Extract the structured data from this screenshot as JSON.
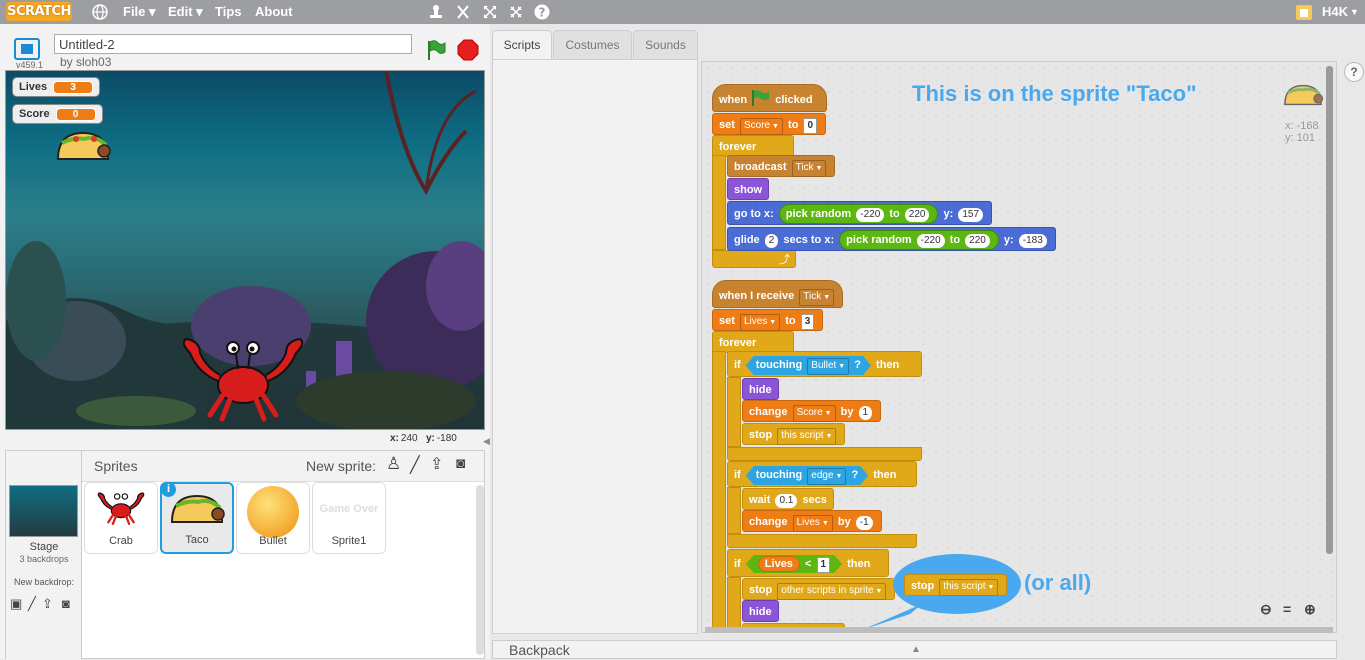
{
  "app": {
    "logo": "SCRATCH",
    "menu": [
      "File ▾",
      "Edit ▾",
      "Tips",
      "About"
    ],
    "user": "H4K"
  },
  "project": {
    "title": "Untitled-2",
    "author": "by sloh03",
    "version": "v459.1"
  },
  "stage": {
    "monitors": [
      {
        "label": "Lives",
        "value": "3"
      },
      {
        "label": "Score",
        "value": "0"
      }
    ],
    "x_label": "x:",
    "x_value": "240",
    "y_label": "y:",
    "y_value": "-180"
  },
  "sprites": {
    "header": "Sprites",
    "new_sprite": "New sprite:",
    "stage_label": "Stage",
    "stage_sub": "3 backdrops",
    "new_backdrop": "New backdrop:",
    "list": [
      "Crab",
      "Taco",
      "Bullet",
      "Sprite1"
    ],
    "game_over_text": "Game Over"
  },
  "tabs": [
    "Scripts",
    "Costumes",
    "Sounds"
  ],
  "script_area": {
    "note": "This is on the sprite \"Taco\"",
    "sprite_x": "x: -168",
    "sprite_y": "y: 101",
    "note2": "(or all)"
  },
  "blocks": {
    "when": "when",
    "clicked": "clicked",
    "set": "set",
    "to": "to",
    "score_var": "Score",
    "score_init": "0",
    "forever": "forever",
    "broadcast": "broadcast",
    "tick": "Tick",
    "show": "show",
    "goto": "go to x:",
    "pick_random": "pick random",
    "neg220": "-220",
    "pos220": "220",
    "y_label": "y:",
    "y157": "157",
    "glide": "glide",
    "glide_secs": "2",
    "secs_to_x": "secs to x:",
    "yneg183": "-183",
    "when_receive": "when I receive",
    "lives_var": "Lives",
    "lives_init": "3",
    "if": "if",
    "touching": "touching",
    "bullet": "Bullet",
    "q": "?",
    "then": "then",
    "hide": "hide",
    "change": "change",
    "by": "by",
    "one": "1",
    "stop": "stop",
    "this_script": "this script",
    "edge": "edge",
    "wait": "wait",
    "wait_val": "0.1",
    "secs": "secs",
    "neg1": "-1",
    "lt": "<",
    "other_scripts": "other scripts in sprite"
  },
  "backpack": "Backpack"
}
